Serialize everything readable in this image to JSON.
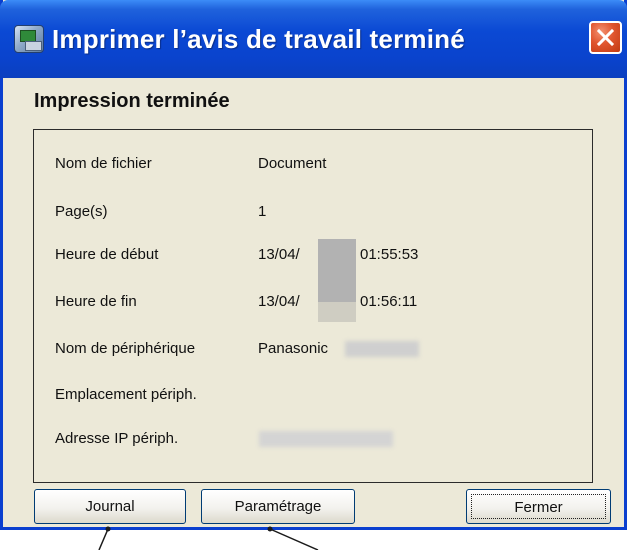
{
  "window": {
    "title": "Imprimer l’avis de travail terminé",
    "icon": "printer-icon",
    "close_icon": "close-icon"
  },
  "heading": "Impression terminée",
  "details": [
    {
      "label": "Nom de fichier",
      "value": "Document"
    },
    {
      "label": "Page(s)",
      "value": "1"
    },
    {
      "label": "Heure de début",
      "value_prefix": "13/04/",
      "value_suffix": "01:55:53"
    },
    {
      "label": "Heure de fin",
      "value_prefix": "13/04/",
      "value_suffix": "01:56:11"
    },
    {
      "label": "Nom de périphérique",
      "value": "Panasonic"
    },
    {
      "label": "Emplacement périph.",
      "value": ""
    },
    {
      "label": "Adresse IP périph.",
      "value": ""
    }
  ],
  "buttons": {
    "journal": "Journal",
    "parametrage": "Paramétrage",
    "fermer": "Fermer"
  },
  "colors": {
    "titlebar": "#0a43cd",
    "dialog_bg": "#ece9d8",
    "close_button": "#e0552e"
  }
}
